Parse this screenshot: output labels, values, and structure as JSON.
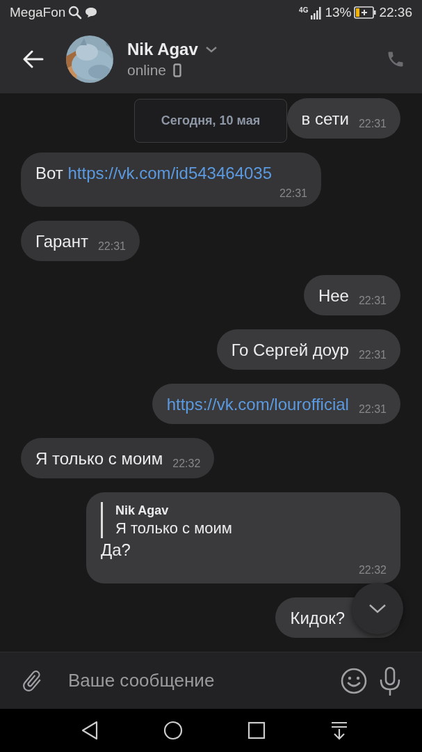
{
  "status_bar": {
    "carrier": "MegaFon",
    "network": "4G",
    "battery_percent": "13%",
    "time": "22:36"
  },
  "header": {
    "name": "Nik Agav",
    "status": "online"
  },
  "date_label": "Сегодня, 10 мая",
  "messages": [
    {
      "kind": "outgoing",
      "parts": [
        {
          "kind": "plain",
          "text": "в сети"
        }
      ],
      "time": "22:31"
    },
    {
      "kind": "incoming",
      "parts": [
        {
          "kind": "plain",
          "text": "Вот "
        },
        {
          "kind": "link",
          "text": "https://vk.com/id543464035"
        }
      ],
      "time": "22:31"
    },
    {
      "kind": "incoming",
      "parts": [
        {
          "kind": "plain",
          "text": "Гарант"
        }
      ],
      "time": "22:31"
    },
    {
      "kind": "outgoing",
      "parts": [
        {
          "kind": "plain",
          "text": "Нее"
        }
      ],
      "time": "22:31"
    },
    {
      "kind": "outgoing",
      "parts": [
        {
          "kind": "plain",
          "text": "Го Сергей доур"
        }
      ],
      "time": "22:31"
    },
    {
      "kind": "outgoing",
      "parts": [
        {
          "kind": "link",
          "text": "https://vk.com/lourofficial"
        }
      ],
      "time": "22:31"
    },
    {
      "kind": "incoming",
      "parts": [
        {
          "kind": "plain",
          "text": "Я только с моим"
        }
      ],
      "time": "22:32"
    },
    {
      "kind": "outgoing",
      "reply": {
        "author": "Nik Agav",
        "text": "Я только с моим"
      },
      "parts": [
        {
          "kind": "plain",
          "text": "Да?"
        }
      ],
      "time": "22:32"
    },
    {
      "kind": "outgoing",
      "parts": [
        {
          "kind": "plain",
          "text": "Кидок?"
        }
      ]
    }
  ],
  "composer": {
    "placeholder": "Ваше сообщение"
  }
}
